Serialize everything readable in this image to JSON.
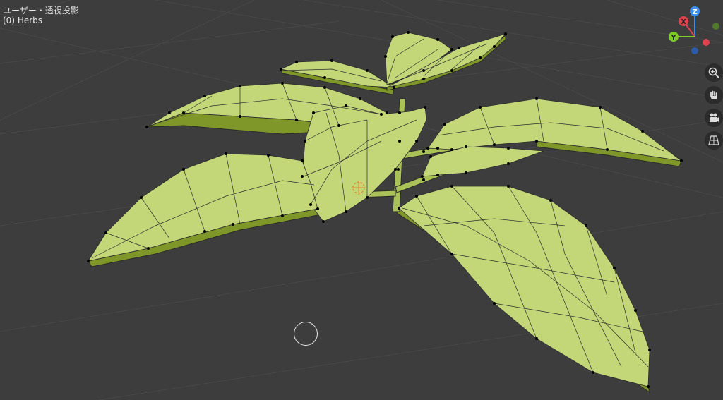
{
  "viewport": {
    "view_label": "ユーザー・透視投影",
    "object_label": "(0) Herbs"
  },
  "gizmo": {
    "axis_z": "Z",
    "axis_x": "X",
    "axis_y": "Y",
    "color_x": "#e0434e",
    "color_y": "#7dcd24",
    "color_z": "#3a8ff0"
  },
  "tools": [
    "zoom-icon",
    "hand-pan-icon",
    "camera-icon",
    "grid-ortho-icon"
  ],
  "colors": {
    "background": "#3d3d3d",
    "leaf": "#c2d675",
    "leaf_dark": "#8aa12e",
    "edge": "#1f1f1f",
    "vertex": "#000000"
  }
}
